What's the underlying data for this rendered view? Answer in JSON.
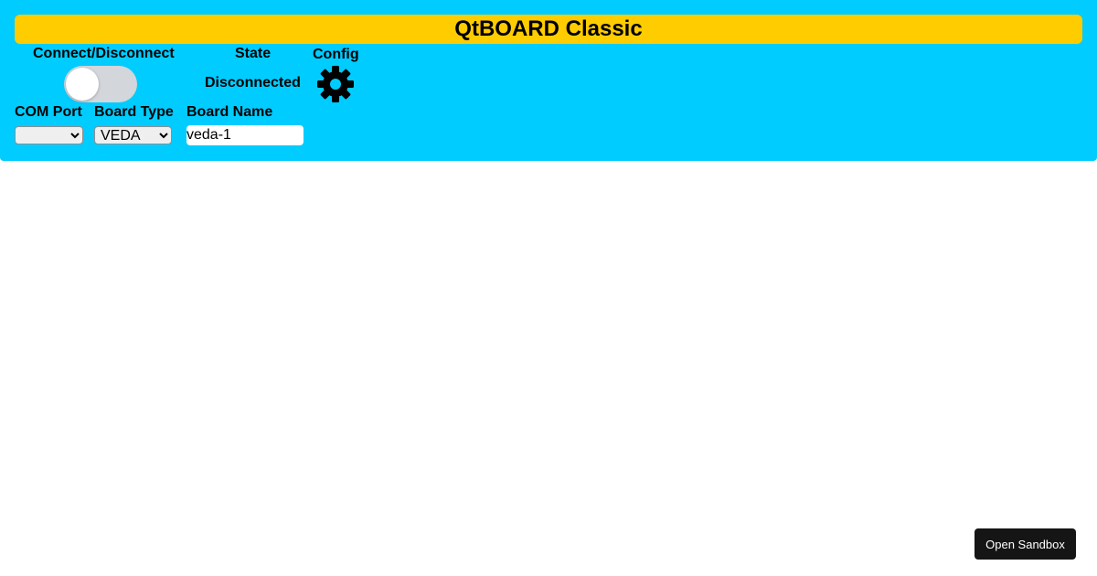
{
  "app": {
    "title": "QtBOARD Classic"
  },
  "connection": {
    "label": "Connect/Disconnect",
    "connected": false
  },
  "state": {
    "label": "State",
    "value": "Disconnected"
  },
  "config": {
    "label": "Config",
    "icon": "gear-icon"
  },
  "com_port": {
    "label": "COM Port",
    "selected": ""
  },
  "board_type": {
    "label": "Board Type",
    "selected": "VEDA"
  },
  "board_name": {
    "label": "Board Name",
    "value": "veda-1"
  },
  "sandbox": {
    "label": "Open Sandbox"
  },
  "colors": {
    "panel": "#00ccff",
    "title_bar": "#ffcc00",
    "toggle_off": "#d3d6da",
    "sandbox_button": "#151515"
  }
}
